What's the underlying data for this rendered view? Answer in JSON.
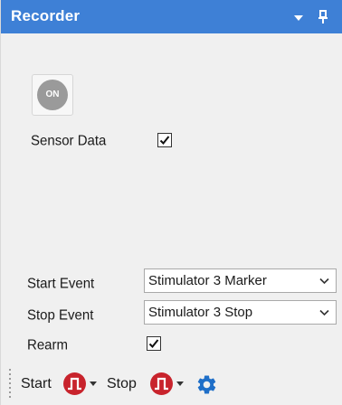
{
  "window": {
    "title": "Recorder",
    "dropdown_icon": "chevron-down-icon",
    "pin_icon": "pin-icon"
  },
  "power": {
    "label": "ON",
    "state": "off"
  },
  "sensor_data": {
    "label": "Sensor Data",
    "checked": true
  },
  "start_event": {
    "label": "Start Event",
    "value": "Stimulator 3 Marker"
  },
  "stop_event": {
    "label": "Stop Event",
    "value": "Stimulator 3 Stop"
  },
  "rearm": {
    "label": "Rearm",
    "checked": true
  },
  "toolbar": {
    "start_label": "Start",
    "stop_label": "Stop",
    "pulse_icon": "pulse-icon",
    "settings_icon": "gear-icon"
  },
  "colors": {
    "titlebar": "#3e80d6",
    "pulse_button": "#c8232c",
    "gear": "#1f6fc8",
    "background": "#f0f0f0"
  }
}
